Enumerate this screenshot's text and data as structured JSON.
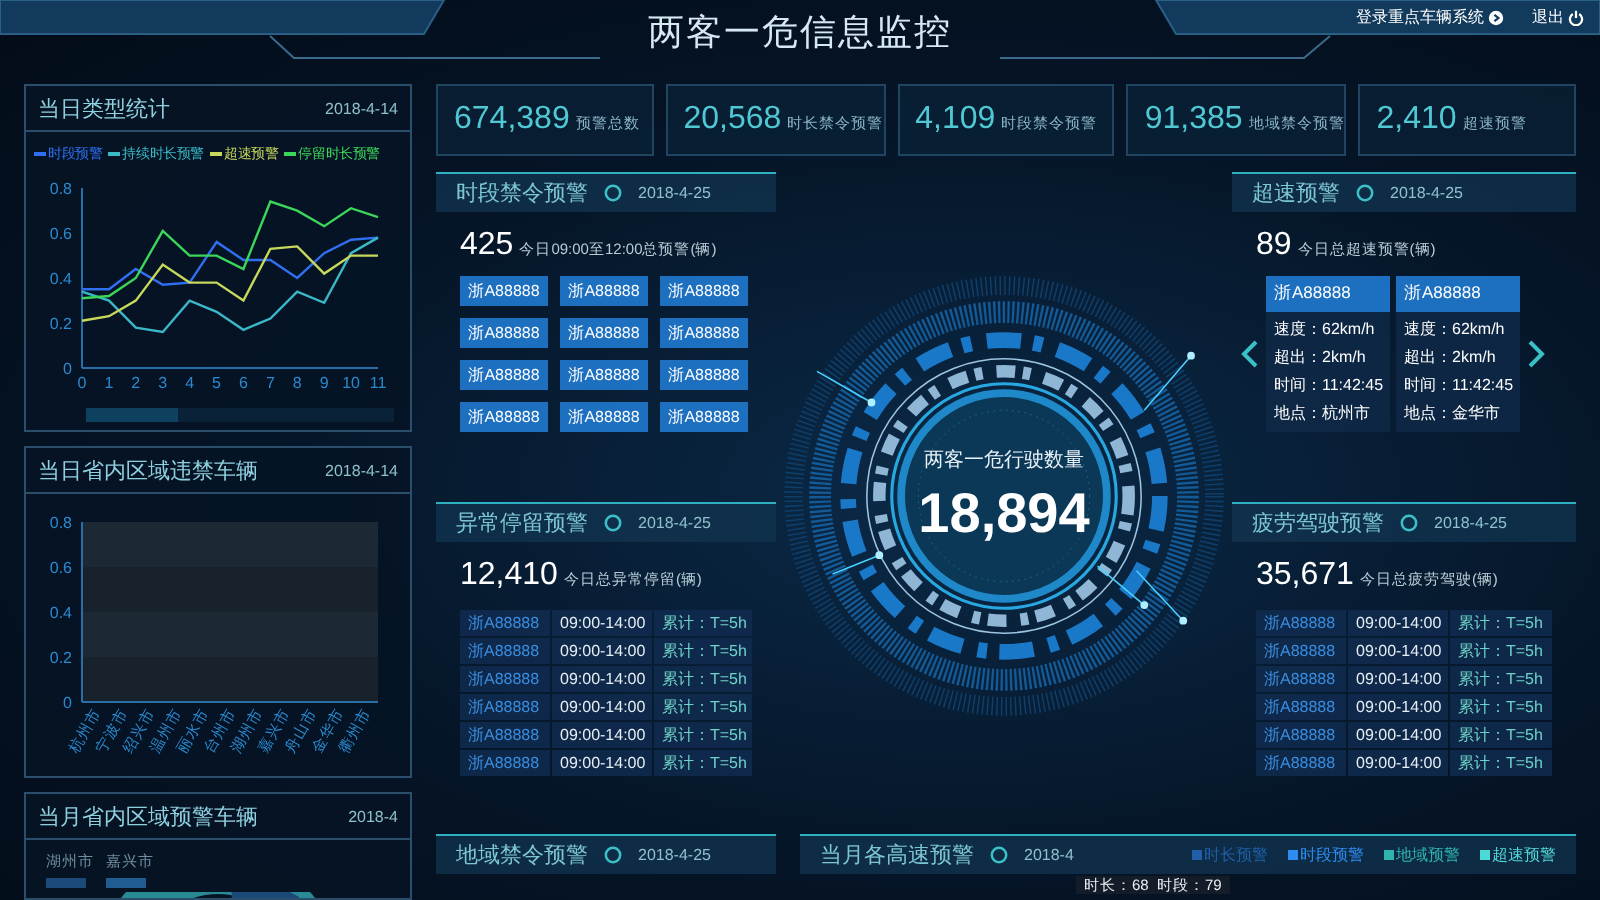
{
  "header": {
    "title": "两客一危信息监控",
    "links": [
      {
        "label": "登录重点车辆系统",
        "kind": "login"
      },
      {
        "label": "退出",
        "kind": "logout"
      }
    ]
  },
  "stats": [
    {
      "value": "674,389",
      "label": "预警总数"
    },
    {
      "value": "20,568",
      "label": "时长禁令预警"
    },
    {
      "value": "4,109",
      "label": "时段禁令预警"
    },
    {
      "value": "91,385",
      "label": "地域禁令预警"
    },
    {
      "value": "2,410",
      "label": "超速预警"
    }
  ],
  "side_panels": [
    {
      "kind": "chart",
      "title": "当日类型统计",
      "date": "2018-4-14",
      "range_slider": {
        "level": 0.3
      },
      "chart_data": {
        "type": "line",
        "x": [
          0,
          1,
          2,
          3,
          4,
          5,
          6,
          7,
          8,
          9,
          10,
          11
        ],
        "xlim": [
          0,
          11
        ],
        "ylim": [
          0,
          0.8
        ],
        "yticks": [
          0,
          0.2,
          0.4,
          0.6,
          0.8
        ],
        "xticks": [
          0,
          1,
          2,
          3,
          4,
          5,
          6,
          7,
          8,
          9,
          10,
          11
        ],
        "series": [
          {
            "name": "时段预警",
            "color": "#2f6ff0",
            "values": [
              0.35,
              0.35,
              0.44,
              0.37,
              0.38,
              0.56,
              0.48,
              0.48,
              0.4,
              0.51,
              0.57,
              0.58
            ]
          },
          {
            "name": "持续时长预警",
            "color": "#3bb8c8",
            "values": [
              0.34,
              0.3,
              0.18,
              0.16,
              0.3,
              0.25,
              0.17,
              0.22,
              0.34,
              0.29,
              0.51,
              0.58
            ]
          },
          {
            "name": "超速预警",
            "color": "#c8d85a",
            "values": [
              0.21,
              0.23,
              0.3,
              0.46,
              0.38,
              0.38,
              0.3,
              0.53,
              0.54,
              0.42,
              0.5,
              0.5
            ]
          },
          {
            "name": "停留时长预警",
            "color": "#3cd65a",
            "values": [
              0.31,
              0.32,
              0.4,
              0.61,
              0.5,
              0.5,
              0.44,
              0.74,
              0.7,
              0.63,
              0.71,
              0.67
            ]
          }
        ]
      }
    },
    {
      "kind": "chart",
      "title": "当日省内区域违禁车辆",
      "date": "2018-4-14",
      "chart_data": {
        "type": "bar",
        "categories": [
          "杭州市",
          "宁波市",
          "绍兴市",
          "温州市",
          "丽水市",
          "台州市",
          "湖州市",
          "嘉兴市",
          "舟山市",
          "金华市",
          "衢州市"
        ],
        "values": [
          0,
          0,
          0,
          0,
          0,
          0,
          0,
          0,
          0,
          0,
          0
        ],
        "ylim": [
          0,
          0.8
        ],
        "yticks": [
          0,
          0.2,
          0.4,
          0.6,
          0.8
        ]
      }
    },
    {
      "kind": "donut",
      "title": "当月省内区域预警车辆",
      "date": "2018-4",
      "legend": [
        {
          "label": "湖州市",
          "color": "#1c4a78"
        },
        {
          "label": "嘉兴市",
          "color": "#1f5c92"
        }
      ]
    }
  ],
  "center": {
    "label": "两客一危行驶数量",
    "value": "18,894"
  },
  "sections": [
    {
      "kind": "plates",
      "title": "时段禁令预警",
      "date": "2018-4-25",
      "count": "425",
      "caption": "今日09:00至12:00总预警(辆)",
      "plates": [
        "浙A88888",
        "浙A88888",
        "浙A88888",
        "浙A88888",
        "浙A88888",
        "浙A88888",
        "浙A88888",
        "浙A88888",
        "浙A88888",
        "浙A88888",
        "浙A88888",
        "浙A88888"
      ]
    },
    {
      "kind": "speed",
      "title": "超速预警",
      "date": "2018-4-25",
      "count": "89",
      "caption": "今日总超速预警(辆)",
      "cards": [
        {
          "plate": "浙A88888",
          "lines": [
            "速度：62km/h",
            "超出：2km/h",
            "时间：11:42:45",
            "地点：杭州市"
          ]
        },
        {
          "plate": "浙A88888",
          "lines": [
            "速度：62km/h",
            "超出：2km/h",
            "时间：11:42:45",
            "地点：金华市"
          ]
        }
      ]
    },
    {
      "kind": "table",
      "title": "异常停留预警",
      "date": "2018-4-25",
      "count": "12,410",
      "caption": "今日总异常停留(辆)",
      "rows": [
        [
          "浙A88888",
          "09:00-14:00",
          "累计：T=5h"
        ],
        [
          "浙A88888",
          "09:00-14:00",
          "累计：T=5h"
        ],
        [
          "浙A88888",
          "09:00-14:00",
          "累计：T=5h"
        ],
        [
          "浙A88888",
          "09:00-14:00",
          "累计：T=5h"
        ],
        [
          "浙A88888",
          "09:00-14:00",
          "累计：T=5h"
        ],
        [
          "浙A88888",
          "09:00-14:00",
          "累计：T=5h"
        ]
      ]
    },
    {
      "kind": "table",
      "title": "疲劳驾驶预警",
      "date": "2018-4-25",
      "count": "35,671",
      "caption": "今日总疲劳驾驶(辆)",
      "rows": [
        [
          "浙A88888",
          "09:00-14:00",
          "累计：T=5h"
        ],
        [
          "浙A88888",
          "09:00-14:00",
          "累计：T=5h"
        ],
        [
          "浙A88888",
          "09:00-14:00",
          "累计：T=5h"
        ],
        [
          "浙A88888",
          "09:00-14:00",
          "累计：T=5h"
        ],
        [
          "浙A88888",
          "09:00-14:00",
          "累计：T=5h"
        ],
        [
          "浙A88888",
          "09:00-14:00",
          "累计：T=5h"
        ]
      ]
    },
    {
      "kind": "header_only",
      "title": "地域禁令预警",
      "date": "2018-4-25"
    },
    {
      "kind": "legend",
      "title": "当月各高速预警",
      "date": "2018-4",
      "legend": [
        {
          "label": "时长预警",
          "color": "#1f5fa8"
        },
        {
          "label": "时段预警",
          "color": "#2d8cf0"
        },
        {
          "label": "地域预警",
          "color": "#2fb5b0"
        },
        {
          "label": "超速预警",
          "color": "#4fd8d8"
        }
      ],
      "tooltip": "时长：68  时段：79"
    }
  ]
}
